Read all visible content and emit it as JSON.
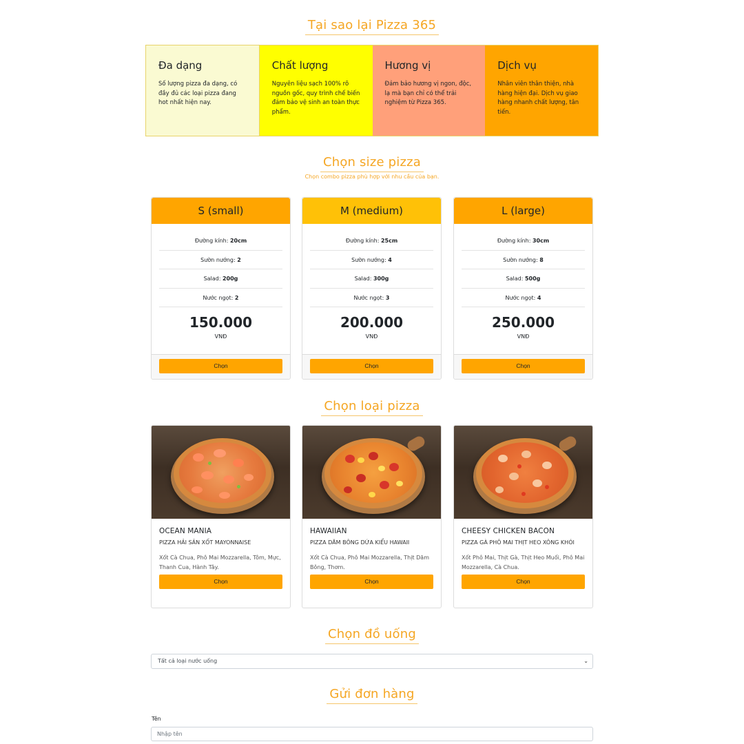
{
  "why_section": {
    "title": "Tại sao lại Pizza 365",
    "items": [
      {
        "title": "Đa dạng",
        "text": "Số lượng pizza đa dạng, có đầy đủ các loại pizza đang hot nhất hiện nay.",
        "color": "#fafad2"
      },
      {
        "title": "Chất lượng",
        "text": "Nguyên liệu sạch 100% rõ nguồn gốc, quy trình chế biến đảm bảo vệ sinh an toàn thực phẩm.",
        "color": "#ffff00"
      },
      {
        "title": "Hương vị",
        "text": "Đảm bảo hương vị ngon, độc, lạ mà bạn chỉ có thể trải nghiệm từ Pizza 365.",
        "color": "#ffa07a"
      },
      {
        "title": "Dịch vụ",
        "text": "Nhân viên thân thiện, nhà hàng hiện đại. Dịch vụ giao hàng nhanh chất lượng, tân tiến.",
        "color": "#ffa500"
      }
    ]
  },
  "size_section": {
    "title": "Chọn size pizza",
    "subtitle": "Chọn combo pizza phù hợp với nhu cầu của bạn.",
    "row_labels": {
      "diameter": "Đường kính: ",
      "ribs": "Sườn nướng: ",
      "salad": "Salad: ",
      "drink": "Nước ngọt: "
    },
    "plans": [
      {
        "name": "S (small)",
        "diameter": "20cm",
        "ribs": "2",
        "salad": "200g",
        "drink": "2",
        "price": "150.000",
        "unit": "VNĐ",
        "button": "Chọn",
        "color": "#ffa500"
      },
      {
        "name": "M (medium)",
        "diameter": "25cm",
        "ribs": "4",
        "salad": "300g",
        "drink": "3",
        "price": "200.000",
        "unit": "VNĐ",
        "button": "Chọn",
        "color": "#ffc107"
      },
      {
        "name": "L (large)",
        "diameter": "30cm",
        "ribs": "8",
        "salad": "500g",
        "drink": "4",
        "price": "250.000",
        "unit": "VNĐ",
        "button": "Chọn",
        "color": "#ffa500"
      }
    ]
  },
  "type_section": {
    "title": "Chọn loại pizza",
    "pizzas": [
      {
        "name": "OCEAN MANIA",
        "subtitle": "PIZZA HẢI SẢN XỐT MAYONNAISE",
        "desc": "Xốt Cà Chua, Phô Mai Mozzarella, Tôm, Mực, Thanh Cua, Hành Tây.",
        "button": "Chọn"
      },
      {
        "name": "HAWAIIAN",
        "subtitle": "PIZZA DĂM BÔNG DỨA KIỂU HAWAII",
        "desc": "Xốt Cà Chua, Phô Mai Mozzarella, Thịt Dăm Bông, Thơm.",
        "button": "Chọn"
      },
      {
        "name": "CHEESY CHICKEN BACON",
        "subtitle": "PIZZA GÀ PHÔ MAI THỊT HEO XÔNG KHÓI",
        "desc": "Xốt Phô Mai, Thịt Gà, Thịt Heo Muối, Phô Mai Mozzarella, Cà Chua.",
        "button": "Chọn"
      }
    ]
  },
  "drink_section": {
    "title": "Chọn đồ uống",
    "selected": "Tất cả loại nước uống"
  },
  "order_section": {
    "title": "Gửi đơn hàng",
    "name_label": "Tên",
    "name_placeholder": "Nhập tên"
  },
  "accent_color": "#f5a623"
}
